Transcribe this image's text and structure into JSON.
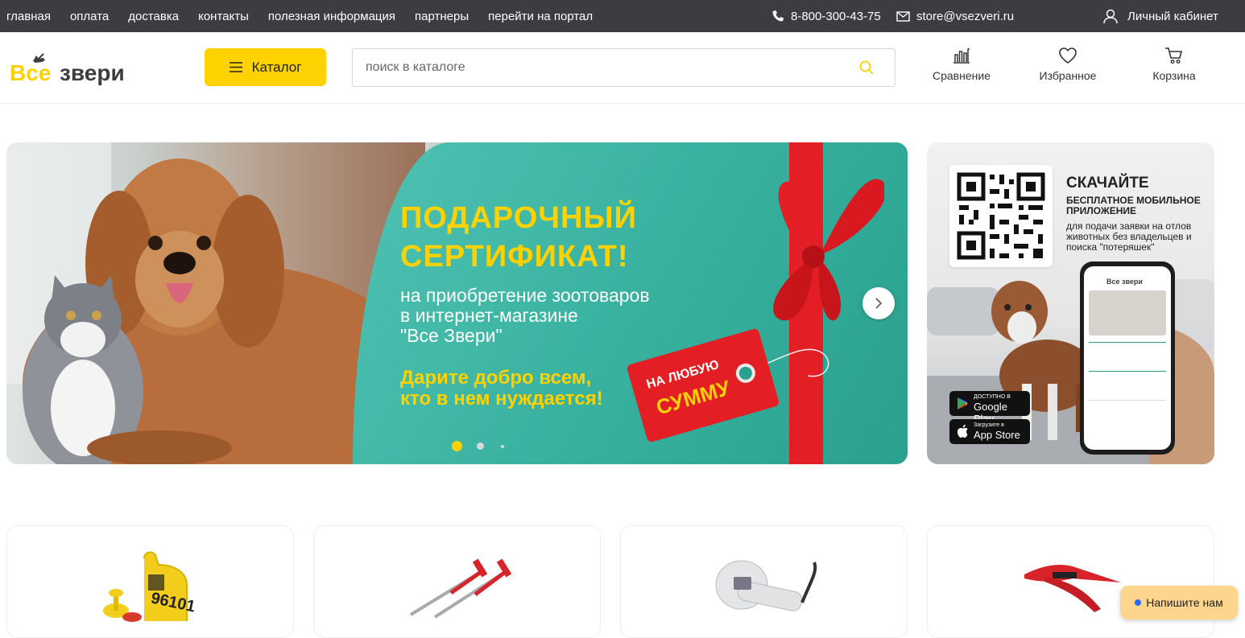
{
  "topbar": {
    "nav": [
      "главная",
      "оплата",
      "доставка",
      "контакты",
      "полезная информация",
      "партнеры",
      "перейти на портал"
    ],
    "phone": "8-800-300-43-75",
    "email": "store@vsezveri.ru",
    "account": "Личный кабинет"
  },
  "header": {
    "logo_text": "Все звери",
    "catalog_label": "Каталог",
    "search_placeholder": "поиск в каталоге",
    "compare_label": "Сравнение",
    "favorites_label": "Избранное",
    "cart_label": "Корзина"
  },
  "banner": {
    "title_line1": "ПОДАРОЧНЫЙ",
    "title_line2": "СЕРТИФИКАТ!",
    "subtitle_line1": "на приобретение зоотоваров",
    "subtitle_line2": "в интернет-магазине",
    "subtitle_line3": "\"Все Звери\"",
    "slogan_line1": "Дарите добро всем,",
    "slogan_line2": "кто в нем нуждается!",
    "tag_line1": "НА ЛЮБУЮ",
    "tag_line2": "СУММУ",
    "slides_total": 3,
    "active_slide": 1
  },
  "app_promo": {
    "heading": "СКАЧАЙТЕ",
    "subheading": "БЕСПЛАТНОЕ МОБИЛЬНОЕ ПРИЛОЖЕНИЕ",
    "description": "для подачи заявки на отлов животных без владельцев и поиска \"потеряшек\"",
    "google_small": "ДОСТУПНО В",
    "google_big": "Google Play",
    "apple_small": "Загрузите в",
    "apple_big": "App Store",
    "phone_logo": "Все звери"
  },
  "products": [
    {
      "icon": "ear-tag-icon",
      "tag_number": "96101"
    },
    {
      "icon": "syringe-icon"
    },
    {
      "icon": "scanner-icon"
    },
    {
      "icon": "pliers-icon"
    }
  ],
  "chat": {
    "label": "Напишите нам"
  },
  "colors": {
    "accent": "#fed200",
    "topbar": "#3c3d40",
    "banner_green": "#35ae9c",
    "ribbon": "#e31e24"
  }
}
